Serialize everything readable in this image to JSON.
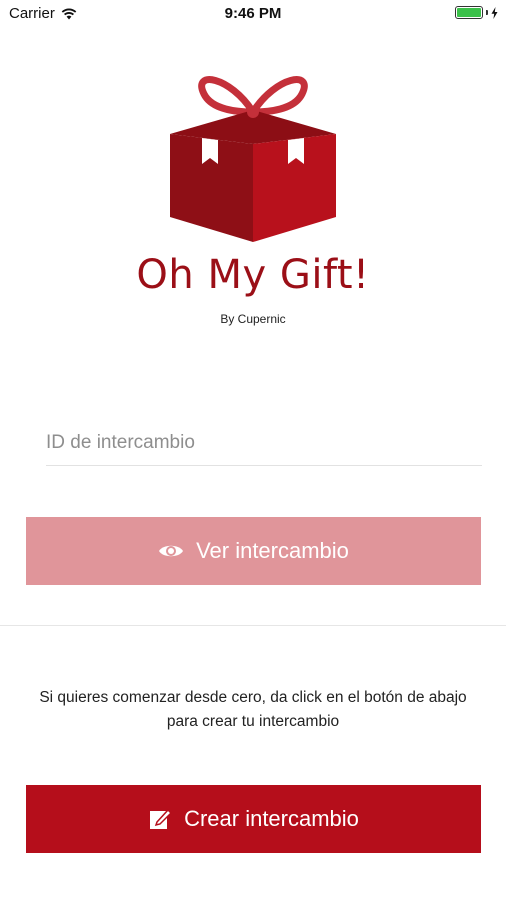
{
  "status_bar": {
    "carrier": "Carrier",
    "time": "9:46 PM",
    "wifi_icon": "wifi-icon",
    "battery_icon": "battery-icon",
    "charging_icon": "charging-bolt-icon",
    "battery_color": "#3bc14a"
  },
  "brand": {
    "logo_icon": "gift-box-icon",
    "title": "Oh My Gift!",
    "subtitle": "By Cupernic",
    "color": "#9b0f17"
  },
  "exchange_id": {
    "placeholder": "ID de intercambio",
    "value": ""
  },
  "view_button": {
    "label": "Ver intercambio",
    "icon": "eye-icon",
    "color": "#e0959a"
  },
  "info_text": "Si quieres comenzar desde cero, da click en el botón de abajo para crear tu intercambio",
  "create_button": {
    "label": "Crear intercambio",
    "icon": "edit-icon",
    "color": "#b50e1b"
  }
}
